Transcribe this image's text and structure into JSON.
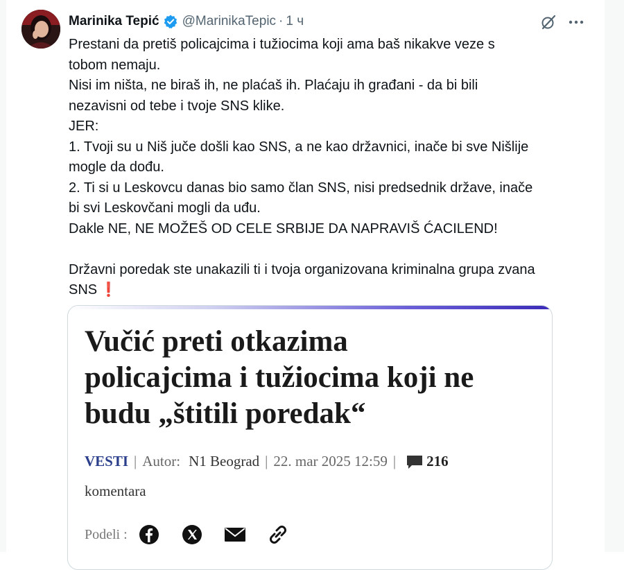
{
  "author": {
    "name": "Marinika Tepić",
    "handle": "@MarinikaTepic",
    "separator": "·",
    "time": "1 ч",
    "verified": true
  },
  "tweet": {
    "lines": [
      "Prestani da pretiš policajcima i tužiocima koji ama baš nikakve veze s",
      "tobom nemaju.",
      "Nisi im ništa, ne biraš ih, ne plaćaš ih. Plaćaju ih građani - da bi bili",
      "nezavisni od tebe i tvoje SNS klike.",
      "JER:",
      "1. Tvoji su u Niš juče došli kao SNS, a ne kao državnici, inače bi sve Nišlije",
      "mogle da dođu.",
      "2. Ti si u Leskovcu danas bio samo član SNS, nisi predsednik države, inače",
      "bi svi Leskovčani mogli da uđu.",
      "Dakle NE, NE MOŽEŠ OD CELE SRBIJE DA NAPRAVIŠ ĆACILEND!",
      "",
      "Državni poredak ste unakazili ti i tvoja organizovana kriminalna grupa zvana"
    ],
    "last_line": "SNS",
    "emoji": "❗"
  },
  "card": {
    "title_lines": [
      "Vučić preti otkazima",
      "policajcima i tužiocima koji ne",
      "budu „štitili poredak“"
    ],
    "section": "VESTI",
    "pipe": "|",
    "author_label": "Autor:",
    "author": "N1 Beograd",
    "date": "22. mar 2025  12:59",
    "comment_count": "216",
    "comments_word": "komentara",
    "share_label": "Podeli :",
    "accent_color": "#2a3e8c"
  },
  "icons": {
    "verified": "verified-badge-icon",
    "grok": "grok-icon",
    "more": "more-icon",
    "comment": "comment-bubble-icon",
    "share": [
      "facebook-icon",
      "x-icon",
      "email-icon",
      "link-icon"
    ]
  }
}
